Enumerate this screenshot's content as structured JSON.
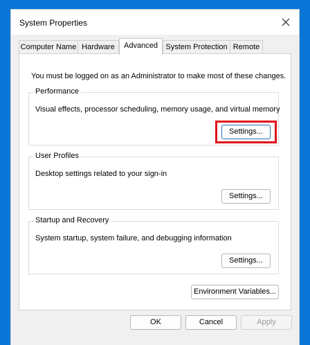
{
  "window": {
    "title": "System Properties"
  },
  "tabs": [
    {
      "label": "Computer Name"
    },
    {
      "label": "Hardware"
    },
    {
      "label": "Advanced"
    },
    {
      "label": "System Protection"
    },
    {
      "label": "Remote"
    }
  ],
  "active_tab": "Advanced",
  "admin_note": "You must be logged on as an Administrator to make most of these changes.",
  "groups": {
    "performance": {
      "title": "Performance",
      "description": "Visual effects, processor scheduling, memory usage, and virtual memory",
      "button": "Settings..."
    },
    "user_profiles": {
      "title": "User Profiles",
      "description": "Desktop settings related to your sign-in",
      "button": "Settings..."
    },
    "startup_recovery": {
      "title": "Startup and Recovery",
      "description": "System startup, system failure, and debugging information",
      "button": "Settings..."
    }
  },
  "env_button": "Environment Variables...",
  "footer": {
    "ok": "OK",
    "cancel": "Cancel",
    "apply": "Apply"
  },
  "colors": {
    "desktop": "#0a76d8",
    "highlight": "#e0101a"
  },
  "icons": {
    "close": "close-icon"
  }
}
